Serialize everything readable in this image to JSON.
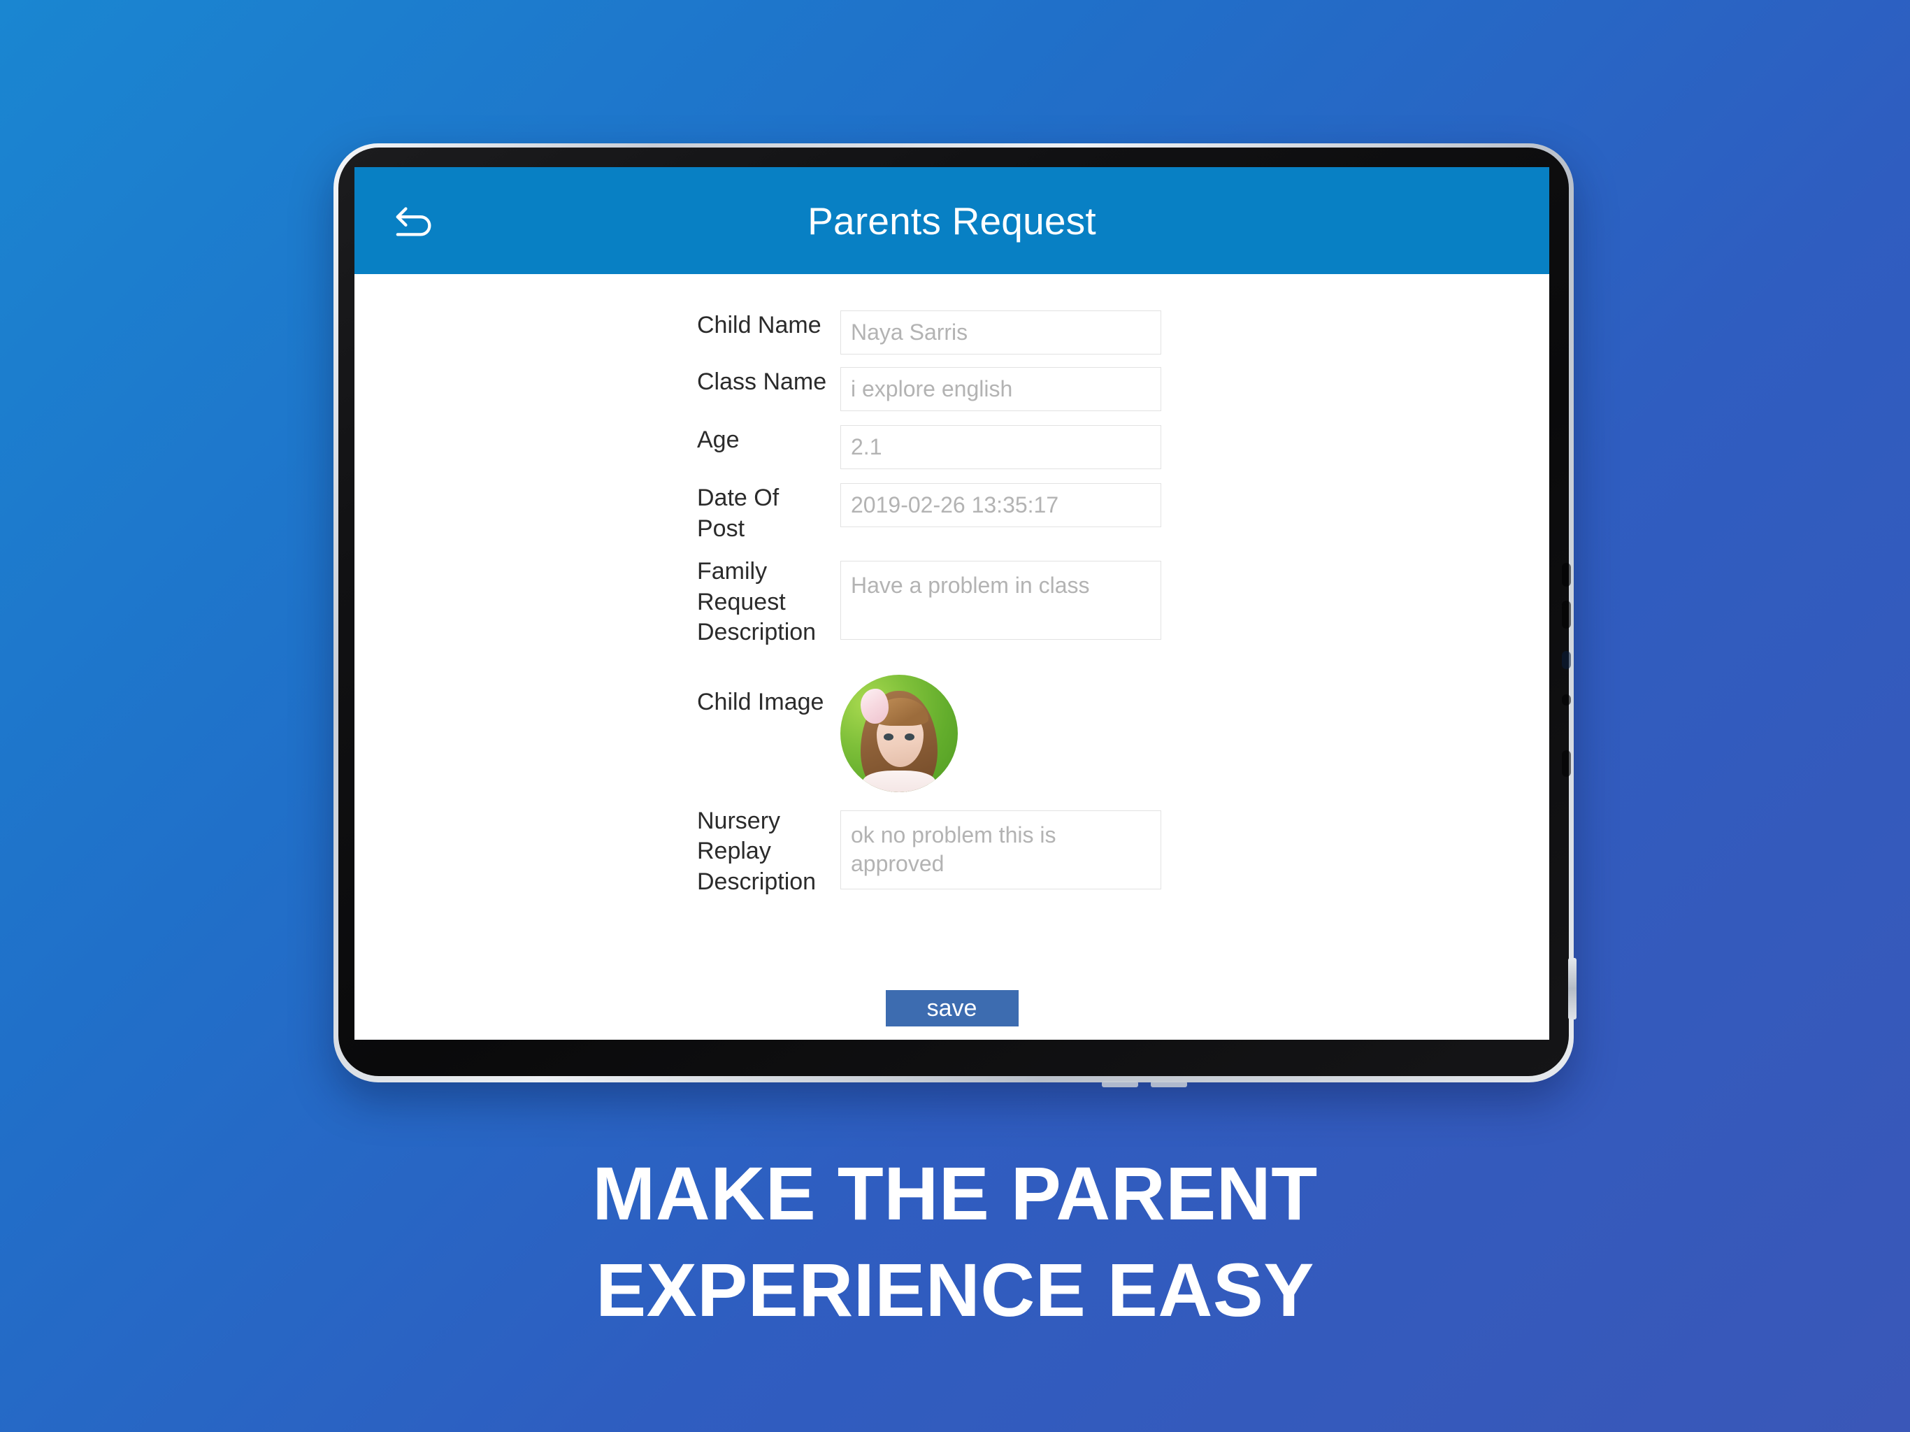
{
  "promo": {
    "caption_line_1": "MAKE THE PARENT",
    "caption_line_2": "EXPERIENCE EASY",
    "background_from": "#1a86d1",
    "background_to": "#3a57b8"
  },
  "app": {
    "header": {
      "title": "Parents Request",
      "background_color": "#0880c4",
      "back_icon": "back-arrow-icon"
    },
    "form": {
      "fields": [
        {
          "label": "Child Name",
          "placeholder": "Naya Sarris",
          "value": "",
          "type": "text"
        },
        {
          "label": "Class Name",
          "placeholder": "i explore english",
          "value": "",
          "type": "text"
        },
        {
          "label": "Age",
          "placeholder": "2.1",
          "value": "",
          "type": "text"
        },
        {
          "label": "Date Of Post",
          "placeholder": "2019-02-26 13:35:17",
          "value": "",
          "type": "text"
        },
        {
          "label": "Family Request Description",
          "placeholder": "Have a problem in class",
          "value": "",
          "type": "textarea"
        },
        {
          "label": "Child Image",
          "placeholder": "",
          "value": "",
          "type": "image"
        },
        {
          "label": "Nursery Replay Description",
          "placeholder": "ok no problem this is approved",
          "value": "",
          "type": "textarea"
        }
      ],
      "save_label": "save",
      "save_color": "#3d6cb0"
    }
  }
}
